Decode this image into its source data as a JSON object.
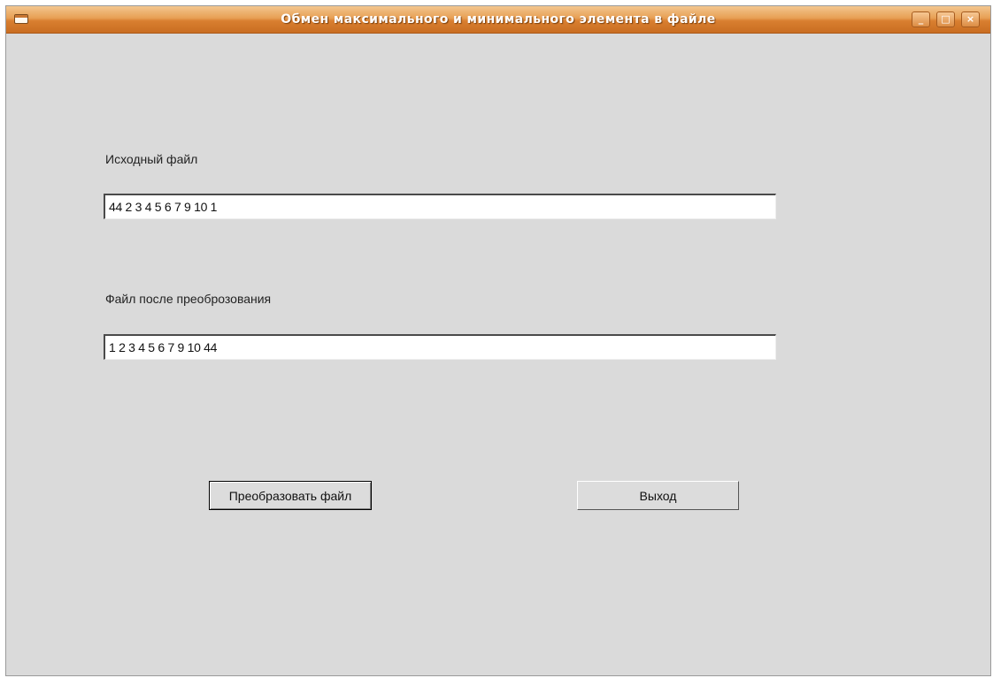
{
  "window": {
    "title": "Обмен максимального и минимального элемента в файле",
    "controls": {
      "minimize": "_",
      "maximize": "□",
      "close": "×"
    }
  },
  "source": {
    "label": "Исходный файл",
    "value": "44 2 3 4 5 6 7 9 10 1"
  },
  "result": {
    "label": "Файл после преоброзования",
    "value": "1 2 3 4 5 6 7 9 10 44"
  },
  "buttons": {
    "convert_label": "Преобразовать файл",
    "exit_label": "Выход"
  },
  "colors": {
    "titlebar": "#e08a3c",
    "window_bg": "#dadada",
    "field_bg": "#ffffff"
  }
}
